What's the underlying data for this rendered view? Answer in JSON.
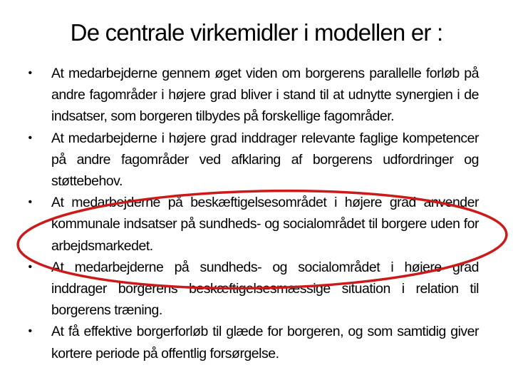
{
  "slide": {
    "title": "De centrale virkemidler i modellen er :",
    "bullet_glyph": "•",
    "bullets": [
      {
        "text": "At medarbejderne gennem øget viden om borgerens parallelle forløb på andre fagområder i højere grad bliver i stand til at udnytte synergien i de indsatser, som borgeren tilbydes på forskellige fagområder."
      },
      {
        "text": "At medarbejderne i højere grad inddrager relevante faglige kompetencer på andre fagområder ved afklaring af borgerens udfordringer og støttebehov."
      },
      {
        "text": "At medarbejderne på beskæftigelsesområdet i højere grad anvender kommunale indsatser på sundheds- og socialområdet til borgere uden for arbejdsmarkedet."
      },
      {
        "text": "At medarbejderne på sundheds- og socialområdet i højere grad inddrager borgerens beskæftigelsesmæssige situation i relation til borgerens træning."
      },
      {
        "text": "At få effektive borgerforløb til glæde for borgeren, og som samtidig giver kortere periode på offentlig forsørgelse."
      }
    ],
    "highlight": {
      "highlighted_bullet_index": 2,
      "color": "#cc1a1a"
    }
  }
}
